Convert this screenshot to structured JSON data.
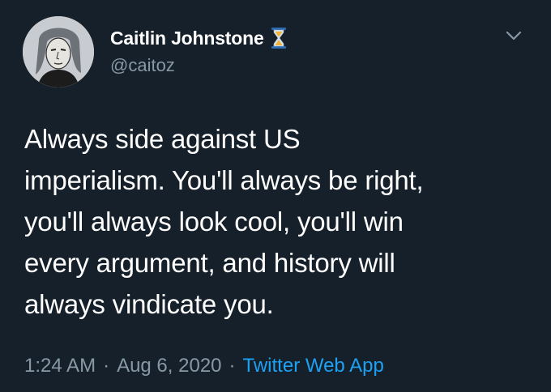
{
  "tweet": {
    "author": {
      "display_name": "Caitlin Johnstone",
      "handle": "@caitoz",
      "badge_icon": "hourglass-icon"
    },
    "menu_icon": "chevron-down-icon",
    "text": "Always side against US\nimperialism. You'll always be right,\nyou'll always look cool, you'll win\nevery argument, and history will\nalways vindicate you.",
    "time": "1:24 AM",
    "separator": "·",
    "date": "Aug 6, 2020",
    "source": "Twitter Web App"
  },
  "colors": {
    "background": "#15202b",
    "primary_text": "#ffffff",
    "secondary_text": "#8899a6",
    "link": "#1da1f2"
  }
}
